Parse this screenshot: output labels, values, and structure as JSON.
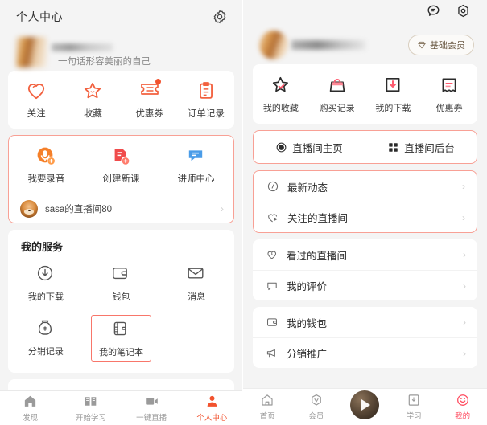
{
  "colors": {
    "accent_orange": "#f2522e",
    "accent_pink": "#ff4a5e",
    "highlight_border": "#f8a095",
    "mic_orange": "#f5802a",
    "doc_red": "#f04b4b",
    "chat_blue": "#4a9ce8",
    "page_bg": "#f4f4f4",
    "card_bg": "#ffffff"
  },
  "left": {
    "header": {
      "title": "个人中心",
      "settings_icon": "gear-icon"
    },
    "profile": {
      "slogan": "一句话形容美丽的自己"
    },
    "quick_actions": [
      {
        "label": "关注",
        "icon": "heart-icon",
        "badge": false
      },
      {
        "label": "收藏",
        "icon": "star-icon",
        "badge": false
      },
      {
        "label": "优惠券",
        "icon": "coupon-icon",
        "badge": true
      },
      {
        "label": "订单记录",
        "icon": "clipboard-icon",
        "badge": false
      }
    ],
    "creator_actions": [
      {
        "label": "我要录音",
        "icon": "microphone-add-icon"
      },
      {
        "label": "创建新课",
        "icon": "document-add-icon"
      },
      {
        "label": "讲师中心",
        "icon": "teacher-center-icon"
      }
    ],
    "live_room": {
      "name": "sasa的直播间80",
      "avatar": "dog-avatar",
      "chevron": "chevron-right-icon"
    },
    "services": {
      "title": "我的服务",
      "items": [
        {
          "label": "我的下载",
          "icon": "download-circle-icon",
          "highlighted": false
        },
        {
          "label": "钱包",
          "icon": "wallet-icon",
          "highlighted": false
        },
        {
          "label": "消息",
          "icon": "envelope-icon",
          "highlighted": false
        },
        {
          "label": "分销记录",
          "icon": "money-bag-icon",
          "highlighted": false
        },
        {
          "label": "我的笔记本",
          "icon": "notebook-icon",
          "highlighted": true
        }
      ]
    },
    "help": {
      "title": "帮助"
    },
    "tabbar": [
      {
        "label": "发现",
        "icon": "home-icon",
        "active": false
      },
      {
        "label": "开始学习",
        "icon": "book-icon",
        "active": false
      },
      {
        "label": "一键直播",
        "icon": "video-camera-icon",
        "active": false
      },
      {
        "label": "个人中心",
        "icon": "person-icon",
        "active": true
      }
    ]
  },
  "right": {
    "top_icons": [
      {
        "name": "message-icon"
      },
      {
        "name": "settings-hex-icon"
      }
    ],
    "vip_badge": {
      "label": "基础会员",
      "icon": "diamond-icon"
    },
    "quick_actions": [
      {
        "label": "我的收藏",
        "icon": "star-check-icon"
      },
      {
        "label": "购买记录",
        "icon": "shopping-bag-icon"
      },
      {
        "label": "我的下载",
        "icon": "download-box-icon"
      },
      {
        "label": "优惠券",
        "icon": "coupon-ticket-icon"
      }
    ],
    "live_entries": [
      {
        "label": "直播间主页",
        "icon": "record-circle-icon"
      },
      {
        "label": "直播间后台",
        "icon": "grid-squares-icon"
      }
    ],
    "list_group_1": [
      {
        "label": "最新动态",
        "icon": "dynamic-icon",
        "chevron": "›"
      },
      {
        "label": "关注的直播间",
        "icon": "heart-play-icon",
        "chevron": "›"
      }
    ],
    "list_group_2": [
      {
        "label": "看过的直播间",
        "icon": "clock-heart-icon",
        "chevron": "›"
      },
      {
        "label": "我的评价",
        "icon": "comment-icon",
        "chevron": "›"
      }
    ],
    "list_group_3": [
      {
        "label": "我的钱包",
        "icon": "wallet-icon",
        "chevron": "›"
      },
      {
        "label": "分销推广",
        "icon": "megaphone-icon",
        "chevron": "›"
      }
    ],
    "tabbar": [
      {
        "label": "首页",
        "icon": "home-icon",
        "active": false
      },
      {
        "label": "会员",
        "icon": "vip-shield-icon",
        "active": false
      },
      {
        "label": "",
        "icon": "play-button-icon",
        "active": false
      },
      {
        "label": "学习",
        "icon": "book-download-icon",
        "active": false
      },
      {
        "label": "我的",
        "icon": "smiley-face-icon",
        "active": true
      }
    ]
  }
}
